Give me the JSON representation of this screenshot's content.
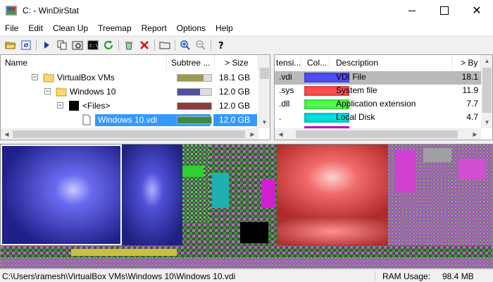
{
  "window": {
    "title": "C: - WinDirStat",
    "icon": "windirstat-app-icon"
  },
  "menu": [
    "File",
    "Edit",
    "Clean Up",
    "Treemap",
    "Report",
    "Options",
    "Help"
  ],
  "toolbar": {
    "icons": [
      "open-folder-icon",
      "refresh-icon",
      "play-icon",
      "copy-path-icon",
      "open-in-explorer-icon",
      "command-prompt-icon",
      "refresh-selected-icon",
      "recycle-icon",
      "delete-icon",
      "new-folder-icon",
      "zoom-in-icon",
      "zoom-out-icon",
      "help-icon"
    ]
  },
  "tree": {
    "headers": {
      "name": "Name",
      "subtree": "Subtree ...",
      "size": "> Size"
    },
    "rows": [
      {
        "name": "VirtualBox VMs",
        "size": "18.1 GB",
        "bar_color": "#9c9c50",
        "fill": 0.78,
        "icon": "folder-icon",
        "indent": 1,
        "expander": "−"
      },
      {
        "name": "Windows 10",
        "size": "12.0 GB",
        "bar_color": "#50509c",
        "fill": 0.66,
        "icon": "folder-icon",
        "indent": 2,
        "expander": "−"
      },
      {
        "name": "<Files>",
        "size": "12.0 GB",
        "bar_color": "#8a3c3c",
        "fill": 1.0,
        "icon": "files-icon",
        "indent": 3,
        "expander": "−"
      },
      {
        "name": "Windows 10.vdi",
        "size": "12.0 GB",
        "bar_color": "#3c8a3c",
        "fill": 1.0,
        "icon": "file-icon",
        "indent": 4,
        "selected": true
      }
    ]
  },
  "extensions": {
    "headers": {
      "ext": "tensi...",
      "color": "Col...",
      "description": "Description",
      "bytes": "> By"
    },
    "rows": [
      {
        "ext": ".vdi",
        "color": "#5050ff",
        "description": "VDI File",
        "bytes": "18.1",
        "selected": true
      },
      {
        "ext": ".sys",
        "color": "#ff5050",
        "description": "System file",
        "bytes": "11.9"
      },
      {
        "ext": ".dll",
        "color": "#50ff50",
        "description": "Application extension",
        "bytes": "7.7"
      },
      {
        "ext": ".",
        "color": "#00e0e0",
        "description": "Local Disk",
        "bytes": "4.7"
      }
    ]
  },
  "status": {
    "path": "C:\\Users\\ramesh\\VirtualBox VMs\\Windows 10\\Windows 10.vdi",
    "ram_label": "RAM Usage:",
    "ram_value": "98.4 MB"
  },
  "colors": {
    "selection": "#3399ff",
    "ext_selection": "#b9b9b9",
    "vdi": "#4040d0",
    "sys": "#e04a4a",
    "dll": "#40d040",
    "cyan": "#00c8c8",
    "magenta": "#c000c0"
  }
}
